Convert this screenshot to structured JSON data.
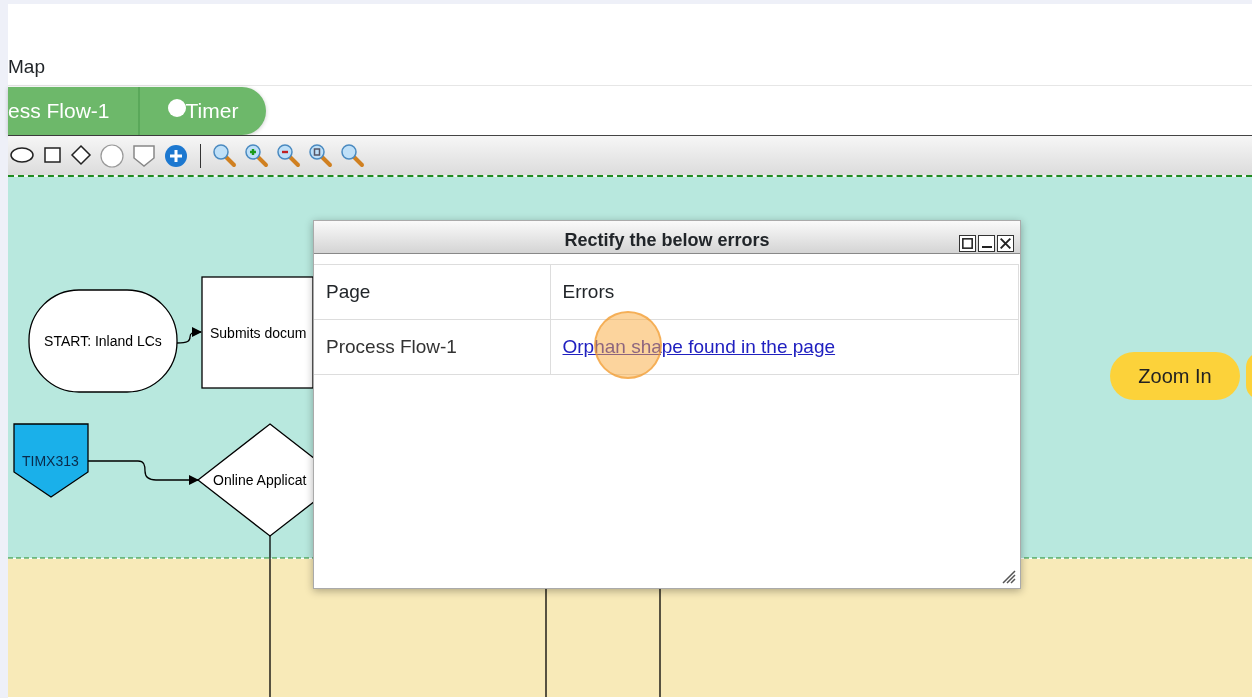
{
  "title": "Map",
  "tabs": [
    {
      "label": "ess Flow-1",
      "icon": false
    },
    {
      "label": "Timer",
      "icon": true
    }
  ],
  "diagram": {
    "nodes": [
      {
        "kind": "terminator",
        "label": "START: Inland LCs"
      },
      {
        "kind": "process",
        "label": "Submits docum"
      },
      {
        "kind": "offpage",
        "label": "TIMX313"
      },
      {
        "kind": "decision",
        "label": "Online Applicat"
      }
    ]
  },
  "dialog": {
    "title": "Rectify the below errors",
    "columns": [
      "Page",
      "Errors"
    ],
    "rows": [
      {
        "page": "Process Flow-1",
        "error": "Orphan shape found in the page"
      }
    ]
  },
  "buttons": [
    {
      "label": "Zoom In"
    }
  ]
}
